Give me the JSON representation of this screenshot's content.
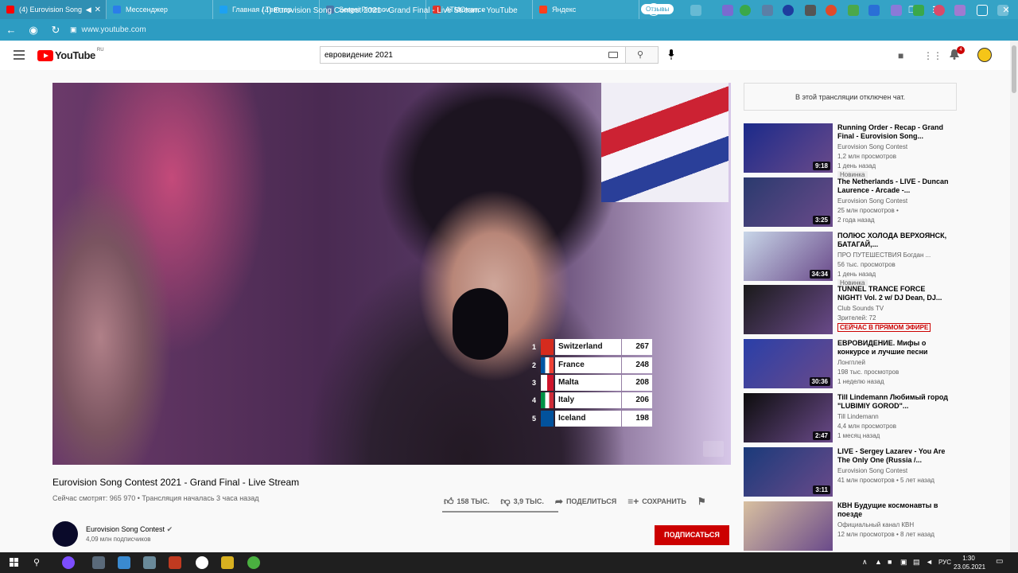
{
  "browser": {
    "tabs": [
      {
        "label": "(4) Eurovision Song",
        "color": "#ff0000",
        "active": true
      },
      {
        "label": "Мессенджер",
        "color": "#2b7de9"
      },
      {
        "label": "Главная / Твиттер",
        "color": "#1da1f2"
      },
      {
        "label": "Sergei Pimenov",
        "color": "#4a76a8"
      },
      {
        "label": "ATMOtrance",
        "color": "#e0352b"
      },
      {
        "label": "Яндекс",
        "color": "#fc3f1d"
      }
    ],
    "url": "www.youtube.com",
    "page_title": "(4) Eurovision Song Contest 2021 - Grand Final - Live Stream - YouTube",
    "reviews_label": "Отзывы"
  },
  "youtube": {
    "logo_text": "YouTube",
    "logo_region": "RU",
    "search_value": "евровидение 2021",
    "notifications_count": "4"
  },
  "video": {
    "scoreboard": [
      {
        "rank": "1",
        "country": "Switzerland",
        "points": "267"
      },
      {
        "rank": "2",
        "country": "France",
        "points": "248"
      },
      {
        "rank": "3",
        "country": "Malta",
        "points": "208"
      },
      {
        "rank": "4",
        "country": "Italy",
        "points": "206"
      },
      {
        "rank": "5",
        "country": "Iceland",
        "points": "198"
      }
    ],
    "title": "Eurovision Song Contest 2021 - Grand Final - Live Stream",
    "meta": "Сейчас смотрят: 965 970 • Трансляция началась 3 часа назад",
    "likes": "158 ТЫС.",
    "dislikes": "3,9 ТЫС.",
    "share_label": "ПОДЕЛИТЬСЯ",
    "save_label": "СОХРАНИТЬ",
    "channel_name": "Eurovision Song Contest",
    "channel_subs": "4,09 млн подписчиков",
    "subscribe_label": "ПОДПИСАТЬСЯ"
  },
  "chat_disabled": "В этой трансляции отключен чат.",
  "recommendations": [
    {
      "title": "Running Order - Recap - Grand Final - Eurovision Song...",
      "channel": "Eurovision Song Contest",
      "views": "1,2 млн просмотров",
      "age": "1 день назад",
      "badge": "Новинка",
      "duration": "9:18",
      "thumb": "#1b2a8a"
    },
    {
      "title": "The Netherlands - LIVE - Duncan Laurence - Arcade -...",
      "channel": "Eurovision Song Contest",
      "views": "25 млн просмотров •",
      "age": "2 года назад",
      "duration": "3:25",
      "thumb": "#2a3a6e"
    },
    {
      "title": "ПОЛЮС ХОЛОДА ВЕРХОЯНСК, БАТАГАЙ,...",
      "channel": "ПРО ПУТЕШЕСТВИЯ Богдан ...",
      "views": "56 тыс. просмотров",
      "age": "1 день назад",
      "badge": "Новинка",
      "duration": "34:34",
      "thumb": "#c8d6e8"
    },
    {
      "title": "TUNNEL TRANCE FORCE NIGHT! Vol. 2 w/ DJ Dean, DJ...",
      "channel": "Club Sounds TV",
      "views": "Зрителей: 72",
      "live": "СЕЙЧАС В ПРЯМОМ ЭФИРЕ",
      "thumb": "#1a1a1a"
    },
    {
      "title": "ЕВРОВИДЕНИЕ. Мифы о конкурсе и лучшие песни",
      "channel": "Лонгплей",
      "views": "198 тыс. просмотров",
      "age": "1 неделю назад",
      "duration": "30:36",
      "thumb": "#2a3fa8"
    },
    {
      "title": "Till Lindemann Любимый город \"LUBIMIY GOROD\"...",
      "channel": "Till Lindemann",
      "views": "4,4 млн просмотров",
      "age": "1 месяц назад",
      "duration": "2:47",
      "thumb": "#0d0d0d"
    },
    {
      "title": "LIVE - Sergey Lazarev - You Are The Only One (Russia /...",
      "channel": "Eurovision Song Contest",
      "views": "41 млн просмотров • 5 лет назад",
      "duration": "3:11",
      "thumb": "#1a3a7a"
    },
    {
      "title": "КВН Будущие космонавты в поезде",
      "channel": "Официальный канал КВН",
      "views": "12 млн просмотров • 8 лет назад",
      "thumb": "#d8c0a0"
    }
  ],
  "taskbar": {
    "lang": "РУС",
    "time": "1:30",
    "date": "23.05.2021"
  }
}
